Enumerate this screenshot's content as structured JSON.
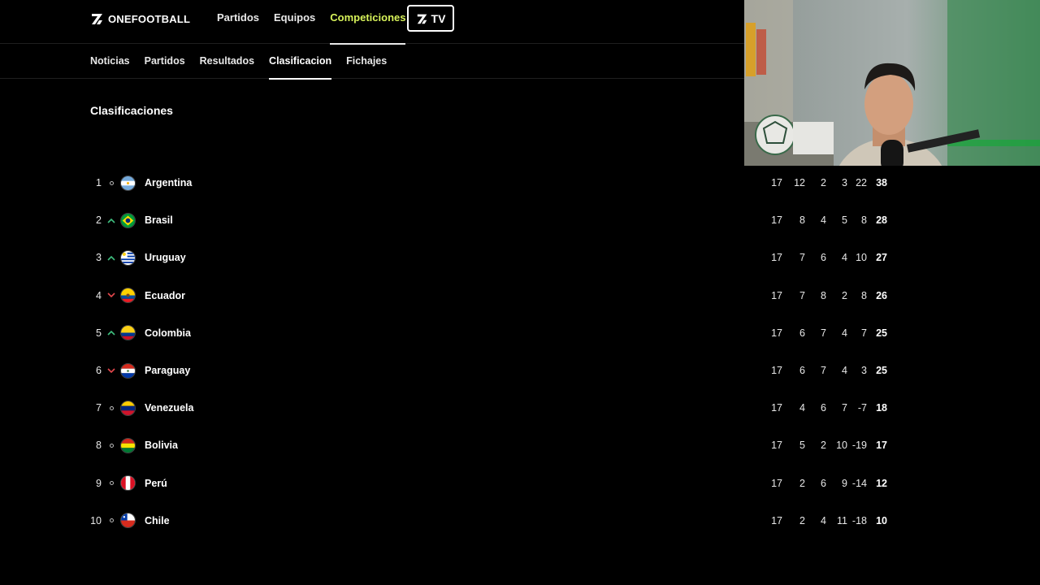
{
  "brand": {
    "name": "ONEFOOTBALL"
  },
  "top_nav": [
    {
      "label": "Partidos",
      "active": false
    },
    {
      "label": "Equipos",
      "active": false
    },
    {
      "label": "Competiciones",
      "active": true
    }
  ],
  "tv_button": {
    "label": "TV"
  },
  "sub_nav": [
    {
      "label": "Noticias",
      "active": false
    },
    {
      "label": "Partidos",
      "active": false
    },
    {
      "label": "Resultados",
      "active": false
    },
    {
      "label": "Clasificacion",
      "active": true
    },
    {
      "label": "Fichajes",
      "active": false
    }
  ],
  "section_title": "Clasificaciones",
  "colors": {
    "accent": "#d7f25a",
    "up": "#3fbf7f",
    "down": "#e5484d",
    "background": "#000000"
  },
  "standings": [
    {
      "pos": "1",
      "trend": "same",
      "flag": "argentina-flag-icon",
      "team": "Argentina",
      "pj": "17",
      "g": "12",
      "e": "2",
      "p": "3",
      "dg": "22",
      "pts": "38"
    },
    {
      "pos": "2",
      "trend": "up",
      "flag": "brazil-flag-icon",
      "team": "Brasil",
      "pj": "17",
      "g": "8",
      "e": "4",
      "p": "5",
      "dg": "8",
      "pts": "28"
    },
    {
      "pos": "3",
      "trend": "up",
      "flag": "uruguay-flag-icon",
      "team": "Uruguay",
      "pj": "17",
      "g": "7",
      "e": "6",
      "p": "4",
      "dg": "10",
      "pts": "27"
    },
    {
      "pos": "4",
      "trend": "down",
      "flag": "ecuador-flag-icon",
      "team": "Ecuador",
      "pj": "17",
      "g": "7",
      "e": "8",
      "p": "2",
      "dg": "8",
      "pts": "26"
    },
    {
      "pos": "5",
      "trend": "up",
      "flag": "colombia-flag-icon",
      "team": "Colombia",
      "pj": "17",
      "g": "6",
      "e": "7",
      "p": "4",
      "dg": "7",
      "pts": "25"
    },
    {
      "pos": "6",
      "trend": "down",
      "flag": "paraguay-flag-icon",
      "team": "Paraguay",
      "pj": "17",
      "g": "6",
      "e": "7",
      "p": "4",
      "dg": "3",
      "pts": "25"
    },
    {
      "pos": "7",
      "trend": "same",
      "flag": "venezuela-flag-icon",
      "team": "Venezuela",
      "pj": "17",
      "g": "4",
      "e": "6",
      "p": "7",
      "dg": "-7",
      "pts": "18"
    },
    {
      "pos": "8",
      "trend": "same",
      "flag": "bolivia-flag-icon",
      "team": "Bolivia",
      "pj": "17",
      "g": "5",
      "e": "2",
      "p": "10",
      "dg": "-19",
      "pts": "17"
    },
    {
      "pos": "9",
      "trend": "same",
      "flag": "peru-flag-icon",
      "team": "Perú",
      "pj": "17",
      "g": "2",
      "e": "6",
      "p": "9",
      "dg": "-14",
      "pts": "12"
    },
    {
      "pos": "10",
      "trend": "same",
      "flag": "chile-flag-icon",
      "team": "Chile",
      "pj": "17",
      "g": "2",
      "e": "4",
      "p": "11",
      "dg": "-18",
      "pts": "10"
    }
  ]
}
